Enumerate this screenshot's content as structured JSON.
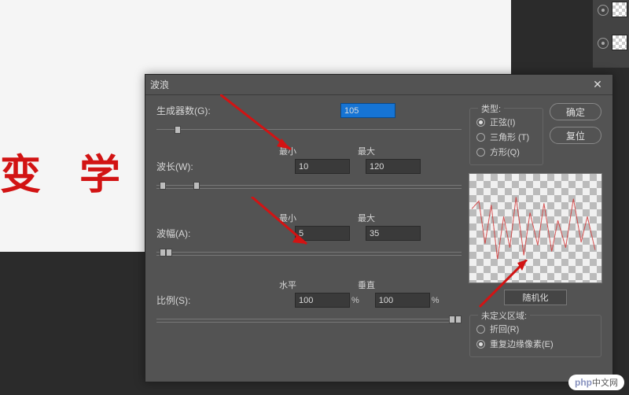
{
  "background_text": "变 学",
  "dialog": {
    "title": "波浪",
    "generators": {
      "label": "生成器数(G):",
      "value": "105"
    },
    "wavelength": {
      "label": "波长(W):",
      "min_label": "最小",
      "max_label": "最大",
      "min": "10",
      "max": "120"
    },
    "amplitude": {
      "label": "波幅(A):",
      "min_label": "最小",
      "max_label": "最大",
      "min": "5",
      "max": "35"
    },
    "scale": {
      "label": "比例(S):",
      "horiz_label": "水平",
      "vert_label": "垂直",
      "horiz": "100",
      "vert": "100",
      "unit": "%"
    },
    "type": {
      "legend": "类型:",
      "sine": "正弦(I)",
      "triangle": "三角形 (T)",
      "square": "方形(Q)"
    },
    "ok": "确定",
    "cancel": "复位",
    "randomize": "随机化",
    "undefined_area": {
      "legend": "未定义区域:",
      "wrap": "折回(R)",
      "repeat": "重复边缘像素(E)"
    }
  },
  "watermark": {
    "php": "php",
    "cn": "中文网"
  }
}
